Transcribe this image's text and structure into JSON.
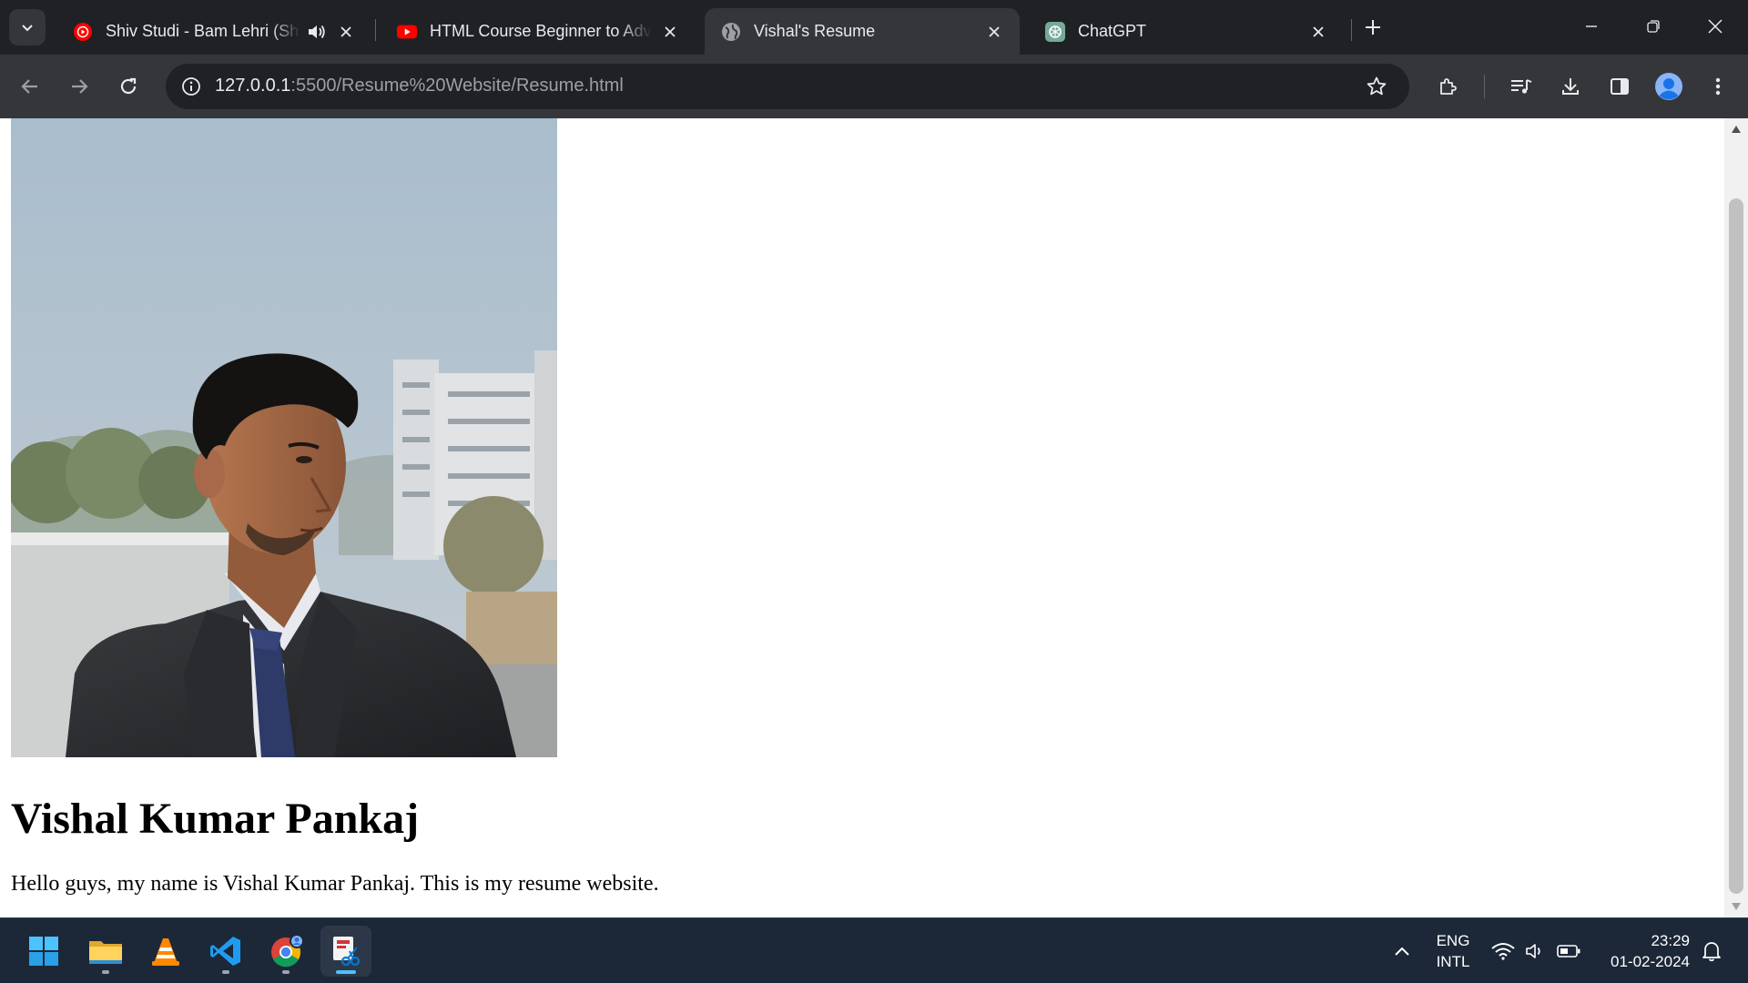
{
  "browser": {
    "tabs": [
      {
        "title": "Shiv Studi - Bam Lehri (Shor",
        "favicon": "youtube-music-icon",
        "audio": "speaker-icon"
      },
      {
        "title": "HTML Course Beginner to Adva",
        "favicon": "youtube-icon"
      },
      {
        "title": "Vishal's Resume",
        "favicon": "globe-icon",
        "active": true
      },
      {
        "title": "ChatGPT",
        "favicon": "chatgpt-icon"
      }
    ],
    "address": {
      "host": "127.0.0.1",
      "path": ":5500/Resume%20Website/Resume.html"
    }
  },
  "page": {
    "photo": "portrait-photo",
    "heading": "Vishal Kumar Pankaj",
    "paragraph": "Hello guys, my name is Vishal Kumar Pankaj. This is my resume website."
  },
  "taskbar": {
    "apps": [
      "windows-start-icon",
      "file-explorer-icon",
      "vlc-icon",
      "vscode-icon",
      "chrome-icon",
      "snipping-tool-icon"
    ],
    "language": {
      "line1": "ENG",
      "line2": "INTL"
    },
    "clock": {
      "time": "23:29",
      "date": "01-02-2024"
    }
  },
  "colors": {
    "titlebar": "#202124",
    "toolbar": "#35363a",
    "taskbar": "#1c2838",
    "accent": "#4cc2ff"
  }
}
